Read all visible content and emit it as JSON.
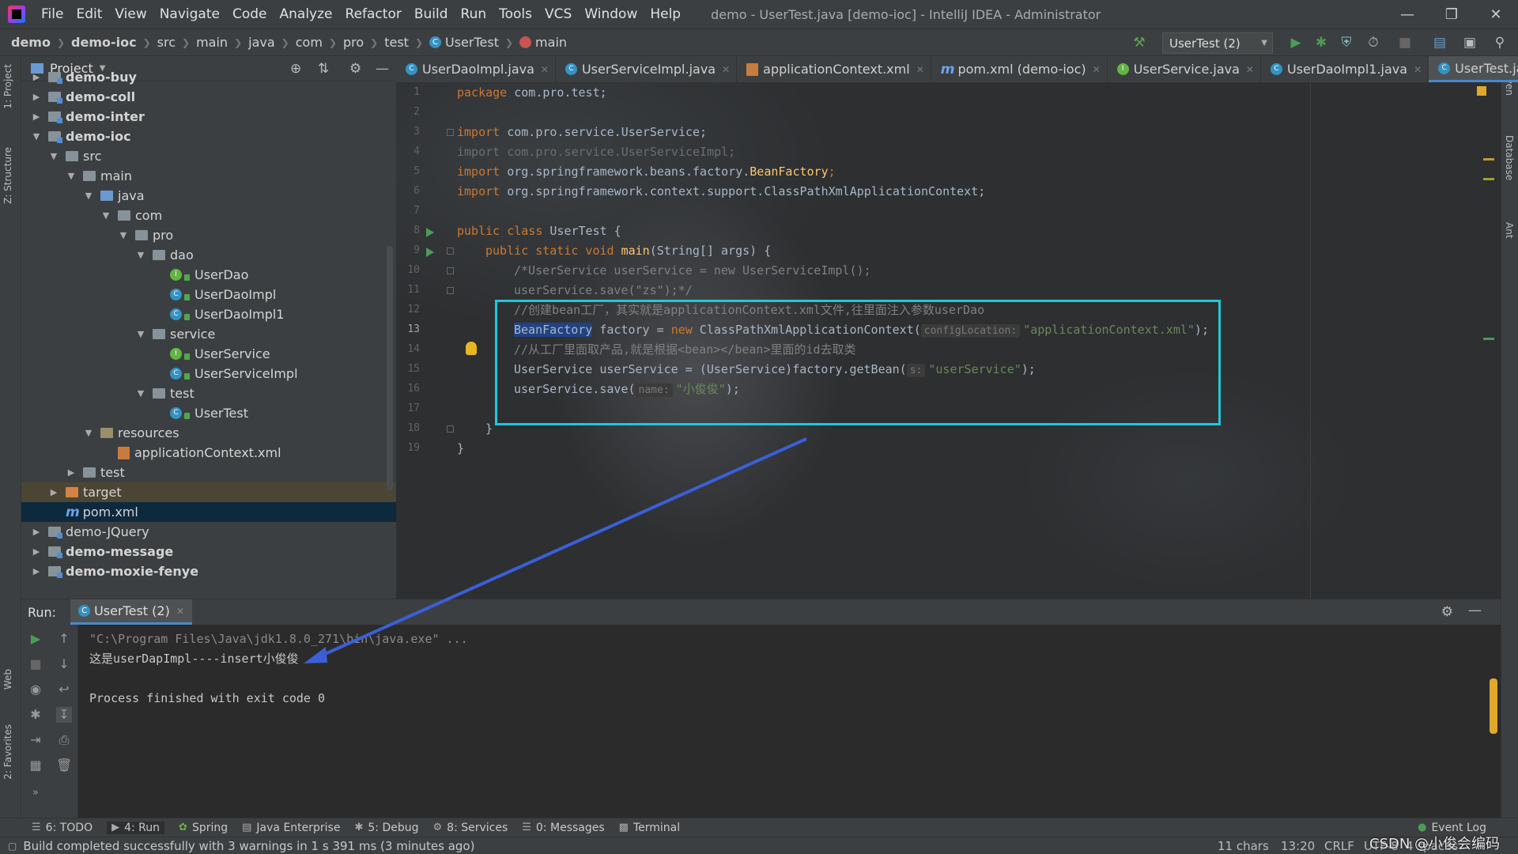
{
  "menu": {
    "items": [
      "File",
      "Edit",
      "View",
      "Navigate",
      "Code",
      "Analyze",
      "Refactor",
      "Build",
      "Run",
      "Tools",
      "VCS",
      "Window",
      "Help"
    ],
    "title": "demo - UserTest.java [demo-ioc] - IntelliJ IDEA - Administrator"
  },
  "breadcrumb": [
    "demo",
    "demo-ioc",
    "src",
    "main",
    "java",
    "com",
    "pro",
    "test",
    "UserTest",
    "main"
  ],
  "run_config": "UserTest (2)",
  "left_strip": {
    "project": "1: Project",
    "structure": "Z: Structure",
    "web": "Web",
    "favorites": "2: Favorites"
  },
  "right_strip": {
    "maven": "Maven",
    "database": "Database",
    "ant": "Ant"
  },
  "project_panel": {
    "title": "Project",
    "tree": [
      {
        "label": "demo-buy",
        "type": "module",
        "bold": true
      },
      {
        "label": "demo-coll",
        "type": "module",
        "bold": true
      },
      {
        "label": "demo-inter",
        "type": "module",
        "bold": true
      },
      {
        "label": "demo-ioc",
        "type": "module",
        "bold": true
      },
      {
        "label": "src",
        "type": "folder"
      },
      {
        "label": "main",
        "type": "folder"
      },
      {
        "label": "java",
        "type": "src"
      },
      {
        "label": "com",
        "type": "folder"
      },
      {
        "label": "pro",
        "type": "folder"
      },
      {
        "label": "dao",
        "type": "folder"
      },
      {
        "label": "UserDao",
        "type": "interface"
      },
      {
        "label": "UserDaoImpl",
        "type": "class"
      },
      {
        "label": "UserDaoImpl1",
        "type": "class"
      },
      {
        "label": "service",
        "type": "folder"
      },
      {
        "label": "UserService",
        "type": "interface"
      },
      {
        "label": "UserServiceImpl",
        "type": "class"
      },
      {
        "label": "test",
        "type": "folder"
      },
      {
        "label": "UserTest",
        "type": "class"
      },
      {
        "label": "resources",
        "type": "res"
      },
      {
        "label": "applicationContext.xml",
        "type": "xml"
      },
      {
        "label": "test",
        "type": "folder"
      },
      {
        "label": "target",
        "type": "target"
      },
      {
        "label": "pom.xml",
        "type": "maven"
      },
      {
        "label": "demo-JQuery",
        "type": "module"
      },
      {
        "label": "demo-message",
        "type": "module",
        "bold": true
      },
      {
        "label": "demo-moxie-fenye",
        "type": "module",
        "bold": true
      }
    ]
  },
  "tabs": [
    {
      "label": "UserDaoImpl.java",
      "icon": "class-icon"
    },
    {
      "label": "UserServiceImpl.java",
      "icon": "class-icon"
    },
    {
      "label": "applicationContext.xml",
      "icon": "xml-icon"
    },
    {
      "label": "pom.xml (demo-ioc)",
      "icon": "maven-icon"
    },
    {
      "label": "UserService.java",
      "icon": "interface-icon"
    },
    {
      "label": "UserDaoImpl1.java",
      "icon": "class-icon"
    },
    {
      "label": "UserTest.java",
      "icon": "class-icon",
      "active": true
    }
  ],
  "editor": {
    "line_numbers": [
      "1",
      "2",
      "3",
      "4",
      "5",
      "6",
      "7",
      "8",
      "9",
      "10",
      "11",
      "12",
      "13",
      "14",
      "15",
      "16",
      "17",
      "18",
      "19"
    ],
    "current_line": "13",
    "code": {
      "l1_kw": "package",
      "l1_rest": " com.pro.test;",
      "l3_kw": "import",
      "l3_rest": " com.pro.service.UserService;",
      "l4": "import com.pro.service.UserServiceImpl;",
      "l5_kw": "import",
      "l5_a": " org.springframework.beans.factory.",
      "l5_b": "BeanFactory",
      "l5_c": ";",
      "l6_kw": "import",
      "l6_rest": " org.springframework.context.support.ClassPathXmlApplicationContext;",
      "l8_kw": "public class",
      "l8_rest": " UserTest {",
      "l9_kw": "public static void",
      "l9_fn": "main",
      "l9_rest": "(String[] args) {",
      "l10": "/*UserService userService = new UserServiceImpl();",
      "l11": "userService.save(\"zs\");*/",
      "l12": "//创建bean工厂，其实就是applicationContext.xml文件,往里面注入参数userDao",
      "l13_hl": "BeanFactory",
      "l13_a": " factory = ",
      "l13_kw": "new",
      "l13_b": " ClassPathXmlApplicationContext(",
      "l13_hint": "configLocation:",
      "l13_str": "\"applicationContext.xml\"",
      "l13_c": ");",
      "l14": "//从工厂里面取产品,就是根据<bean></bean>里面的id去取类",
      "l15_a": "UserService userService = (UserService)factory.getBean(",
      "l15_hint": "s:",
      "l15_str": "\"userService\"",
      "l15_c": ");",
      "l16_a": "userService.save(",
      "l16_hint": "name:",
      "l16_str": "\"小俊俊\"",
      "l16_c": ");",
      "l18": "}",
      "l19": "}"
    }
  },
  "run_panel": {
    "label": "Run:",
    "tab": "UserTest (2)",
    "console": [
      "\"C:\\Program Files\\Java\\jdk1.8.0_271\\bin\\java.exe\" ...",
      "这是userDapImpl----insert小俊俊",
      "",
      "Process finished with exit code 0"
    ]
  },
  "bottom_tools": [
    {
      "label": "6: TODO",
      "icon": "list-icon"
    },
    {
      "label": "4: Run",
      "icon": "play-icon",
      "active": true
    },
    {
      "label": "Spring",
      "icon": "spring-icon"
    },
    {
      "label": "Java Enterprise",
      "icon": "java-ee-icon"
    },
    {
      "label": "5: Debug",
      "icon": "bug-icon"
    },
    {
      "label": "8: Services",
      "icon": "services-icon"
    },
    {
      "label": "0: Messages",
      "icon": "messages-icon"
    },
    {
      "label": "Terminal",
      "icon": "terminal-icon"
    }
  ],
  "event_log": "Event Log",
  "status": {
    "message": "Build completed successfully with 3 warnings in 1 s 391 ms (3 minutes ago)",
    "chars": "11 chars",
    "position": "13:20",
    "line_sep": "CRLF",
    "encoding": "UTF-8",
    "indent": "4 spaces",
    "watermark": "CSDN @小俊会编码"
  },
  "colors": {
    "annotation_box": "#20c8d8",
    "annotation_arrow": "#3a5fd8"
  }
}
